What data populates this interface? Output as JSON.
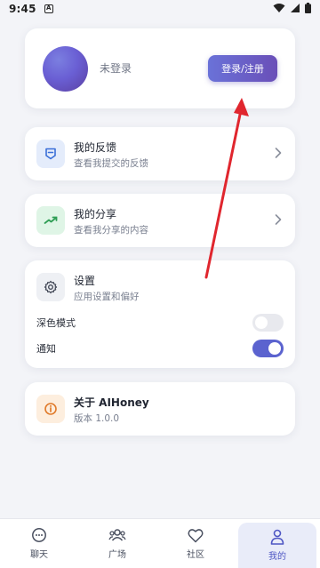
{
  "status_bar": {
    "time": "9:45",
    "notif_letter": "A"
  },
  "profile": {
    "name": "未登录",
    "login_button": "登录/注册"
  },
  "menu": {
    "feedback": {
      "title": "我的反馈",
      "subtitle": "查看我提交的反馈",
      "icon": "feedback-icon"
    },
    "share": {
      "title": "我的分享",
      "subtitle": "查看我分享的内容",
      "icon": "share-icon"
    },
    "settings": {
      "title": "设置",
      "subtitle": "应用设置和偏好",
      "icon": "gear-icon"
    },
    "about": {
      "title": "关于 AIHoney",
      "subtitle": "版本 1.0.0",
      "icon": "info-icon"
    }
  },
  "settings_options": {
    "dark_mode": {
      "label": "深色模式",
      "enabled": false
    },
    "notifications": {
      "label": "通知",
      "enabled": true
    }
  },
  "bottom_nav": [
    {
      "label": "聊天",
      "icon": "chat-icon",
      "active": false
    },
    {
      "label": "广场",
      "icon": "users-icon",
      "active": false
    },
    {
      "label": "社区",
      "icon": "heart-icon",
      "active": false
    },
    {
      "label": "我的",
      "icon": "person-icon",
      "active": true
    }
  ],
  "colors": {
    "accent": "#5b63cf",
    "annotation_arrow": "#e0262e"
  }
}
